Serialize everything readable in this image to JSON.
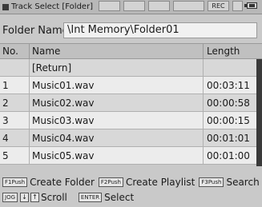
{
  "titlebar": {
    "title": "Track Select [Folder]",
    "rec_label": "REC"
  },
  "folder": {
    "label": "Folder Name",
    "value": "\\Int Memory\\Folder01"
  },
  "table": {
    "headers": {
      "no": "No.",
      "name": "Name",
      "length": "Length"
    },
    "rows": [
      {
        "no": "",
        "name": "[Return]",
        "length": ""
      },
      {
        "no": "1",
        "name": "Music01.wav",
        "length": "00:03:11"
      },
      {
        "no": "2",
        "name": "Music02.wav",
        "length": "00:00:58"
      },
      {
        "no": "3",
        "name": "Music03.wav",
        "length": "00:00:15"
      },
      {
        "no": "4",
        "name": "Music04.wav",
        "length": "00:01:01"
      },
      {
        "no": "5",
        "name": "Music05.wav",
        "length": "00:01:00"
      }
    ]
  },
  "footer": {
    "f1_key": "F1Push",
    "f1_label": "Create Folder",
    "f2_key": "F2Push",
    "f2_label": "Create Playlist",
    "f3_key": "F3Push",
    "f3_label": "Search",
    "jog_key": "JOG",
    "down_arrow": "↓",
    "up_arrow": "↑",
    "scroll_label": "Scroll",
    "enter_key": "ENTER",
    "select_label": "Select"
  }
}
